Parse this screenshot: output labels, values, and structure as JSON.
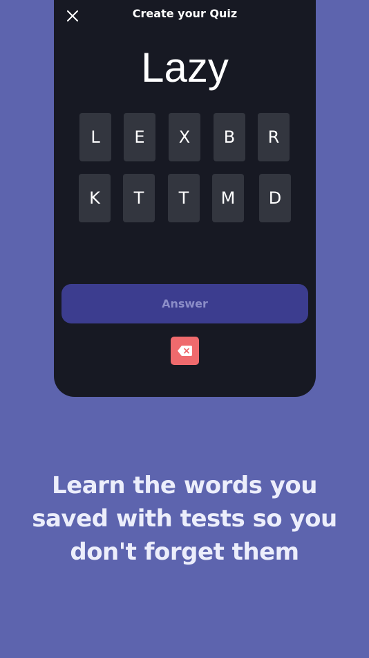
{
  "header": {
    "close_icon": "close-icon",
    "title": "Create your Quiz"
  },
  "quiz": {
    "word": "Lazy",
    "letters_row1": [
      "L",
      "E",
      "X",
      "B",
      "R"
    ],
    "letters_row2": [
      "K",
      "T",
      "T",
      "M",
      "D"
    ]
  },
  "actions": {
    "answer_label": "Answer",
    "delete_icon": "backspace-icon"
  },
  "caption": {
    "text": "Learn the words you saved with tests so you don't forget them"
  },
  "colors": {
    "background": "#5d64ae",
    "card": "#171923",
    "tile": "#33363f",
    "answer_button": "#3c3d8f",
    "answer_text": "#8c8ec8",
    "delete_button": "#ef6a6d",
    "caption_text": "#eceefb"
  }
}
